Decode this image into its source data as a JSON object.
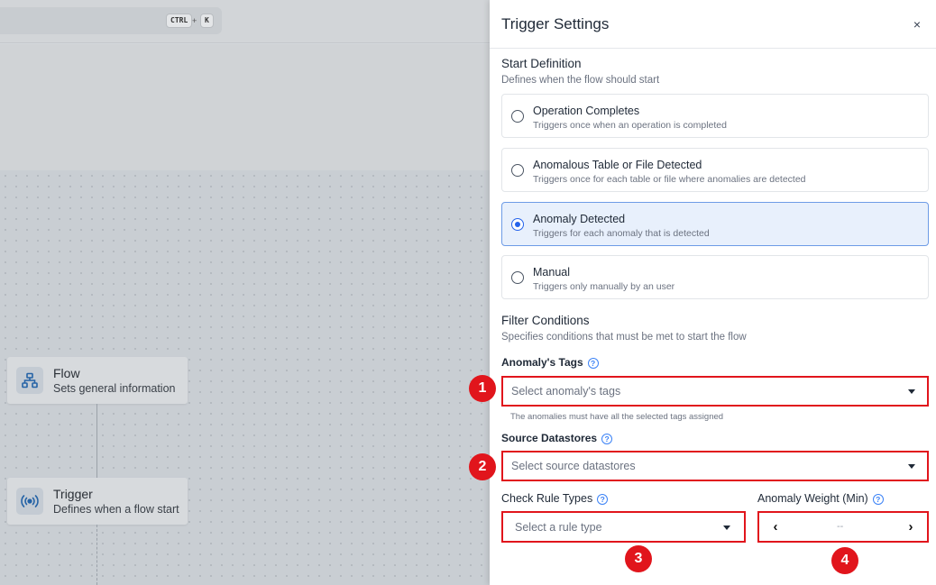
{
  "background": {
    "shortcut": {
      "key1": "CTRL",
      "plus": "+",
      "key2": "K"
    },
    "flow_node": {
      "title": "Flow",
      "subtitle": "Sets general information",
      "icon": "sitemap-icon"
    },
    "trigger_node": {
      "title": "Trigger",
      "subtitle": "Defines when a flow start",
      "icon": "broadcast-icon"
    }
  },
  "panel": {
    "title": "Trigger Settings",
    "close": "×",
    "start_definition": {
      "title": "Start Definition",
      "subtitle": "Defines when the flow should start",
      "options": [
        {
          "label": "Operation Completes",
          "description": "Triggers once when an operation is completed",
          "selected": false
        },
        {
          "label": "Anomalous Table or File Detected",
          "description": "Triggers once for each table or file where anomalies are detected",
          "selected": false
        },
        {
          "label": "Anomaly Detected",
          "description": "Triggers for each anomaly that is detected",
          "selected": true
        },
        {
          "label": "Manual",
          "description": "Triggers only manually by an user",
          "selected": false
        }
      ]
    },
    "filter_conditions": {
      "title": "Filter Conditions",
      "subtitle": "Specifies conditions that must be met to start the flow",
      "anomaly_tags": {
        "label": "Anomaly's Tags",
        "placeholder": "Select anomaly's tags",
        "hint": "The anomalies must have all the selected tags assigned"
      },
      "source_datastores": {
        "label": "Source Datastores",
        "placeholder": "Select source datastores"
      },
      "check_rule_types": {
        "label": "Check Rule Types",
        "placeholder": "Select a rule type"
      },
      "anomaly_weight": {
        "label": "Anomaly Weight (Min)",
        "value": "--",
        "prev": "‹",
        "next": "›"
      }
    },
    "help_glyph": "?"
  },
  "annotations": [
    "1",
    "2",
    "3",
    "4"
  ],
  "colors": {
    "accent": "#2563eb",
    "highlight": "#e1151c",
    "selected_bg": "#e8f0fc"
  }
}
